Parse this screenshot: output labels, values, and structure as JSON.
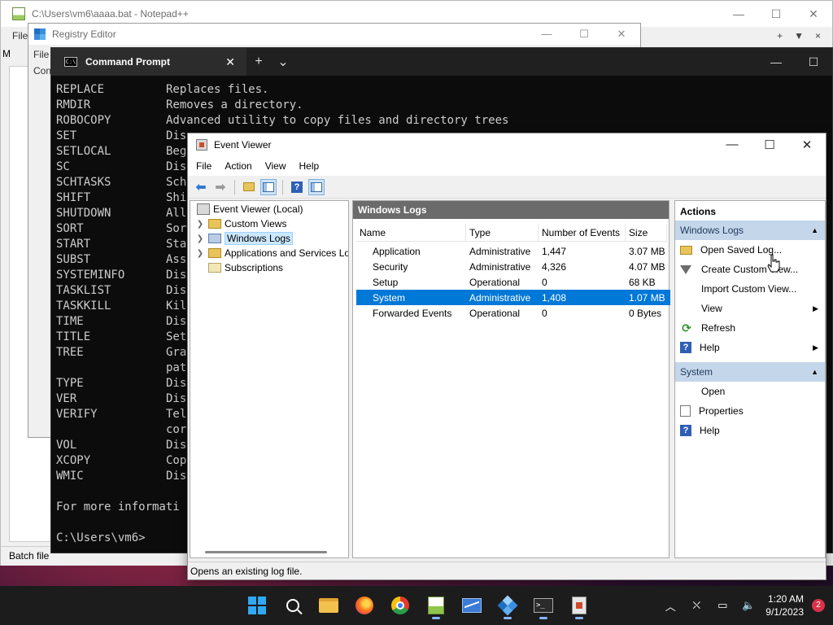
{
  "notepadpp": {
    "title": "C:\\Users\\vm6\\aaaa.bat - Notepad++",
    "menu_first": "File",
    "menu_right": [
      "+",
      "▼",
      "×"
    ],
    "m_letter": "M",
    "status": "Batch file"
  },
  "regedit": {
    "title": "Registry Editor",
    "menu_first": "File",
    "address_prefix": "Con"
  },
  "cmd": {
    "tab_title": "Command Prompt",
    "tab_icon_text": "C:\\",
    "lines": [
      {
        "cmd": "REPLACE",
        "desc": "Replaces files."
      },
      {
        "cmd": "RMDIR",
        "desc": "Removes a directory."
      },
      {
        "cmd": "ROBOCOPY",
        "desc": "Advanced utility to copy files and directory trees"
      },
      {
        "cmd": "SET",
        "desc": "Dis"
      },
      {
        "cmd": "SETLOCAL",
        "desc": "Beg"
      },
      {
        "cmd": "SC",
        "desc": "Dis"
      },
      {
        "cmd": "SCHTASKS",
        "desc": "Sch"
      },
      {
        "cmd": "SHIFT",
        "desc": "Shi"
      },
      {
        "cmd": "SHUTDOWN",
        "desc": "All"
      },
      {
        "cmd": "SORT",
        "desc": "Sor"
      },
      {
        "cmd": "START",
        "desc": "Sta"
      },
      {
        "cmd": "SUBST",
        "desc": "Ass"
      },
      {
        "cmd": "SYSTEMINFO",
        "desc": "Dis"
      },
      {
        "cmd": "TASKLIST",
        "desc": "Dis"
      },
      {
        "cmd": "TASKKILL",
        "desc": "Kil"
      },
      {
        "cmd": "TIME",
        "desc": "Dis"
      },
      {
        "cmd": "TITLE",
        "desc": "Set"
      },
      {
        "cmd": "TREE",
        "desc": "Gra"
      },
      {
        "cmd": "",
        "desc": "pat"
      },
      {
        "cmd": "TYPE",
        "desc": "Dis"
      },
      {
        "cmd": "VER",
        "desc": "Dis"
      },
      {
        "cmd": "VERIFY",
        "desc": "Tel"
      },
      {
        "cmd": "",
        "desc": "cor"
      },
      {
        "cmd": "VOL",
        "desc": "Dis"
      },
      {
        "cmd": "XCOPY",
        "desc": "Cop"
      },
      {
        "cmd": "WMIC",
        "desc": "Dis"
      },
      {
        "cmd": "",
        "desc": ""
      },
      {
        "cmd": "For more informati",
        "desc": ""
      },
      {
        "cmd": "",
        "desc": ""
      },
      {
        "cmd": "C:\\Users\\vm6>",
        "desc": ""
      }
    ]
  },
  "eventviewer": {
    "title": "Event Viewer",
    "menu": [
      "File",
      "Action",
      "View",
      "Help"
    ],
    "tree": {
      "root": "Event Viewer (Local)",
      "custom_views": "Custom Views",
      "windows_logs": "Windows Logs",
      "apps_services": "Applications and Services Lo",
      "subscriptions": "Subscriptions"
    },
    "center": {
      "header": "Windows Logs",
      "columns": [
        "Name",
        "Type",
        "Number of Events",
        "Size"
      ],
      "rows": [
        {
          "name": "Application",
          "type": "Administrative",
          "events": "1,447",
          "size": "3.07 MB"
        },
        {
          "name": "Security",
          "type": "Administrative",
          "events": "4,326",
          "size": "4.07 MB"
        },
        {
          "name": "Setup",
          "type": "Operational",
          "events": "0",
          "size": "68 KB"
        },
        {
          "name": "System",
          "type": "Administrative",
          "events": "1,408",
          "size": "1.07 MB"
        },
        {
          "name": "Forwarded Events",
          "type": "Operational",
          "events": "0",
          "size": "0 Bytes"
        }
      ],
      "selected_row": 3
    },
    "actions": {
      "title": "Actions",
      "section1": "Windows Logs",
      "items1": [
        "Open Saved Log...",
        "Create Custom View...",
        "Import Custom View...",
        "View",
        "Refresh",
        "Help"
      ],
      "section2": "System",
      "items2": [
        "Open",
        "Properties",
        "Help"
      ]
    },
    "status": "Opens an existing log file."
  },
  "taskbar": {
    "time": "1:20 AM",
    "date": "9/1/2023",
    "notification_count": "2"
  },
  "colors": {
    "selection": "#0078d7",
    "section_header": "#c4d6ea",
    "console_bg": "#0c0c0c"
  }
}
